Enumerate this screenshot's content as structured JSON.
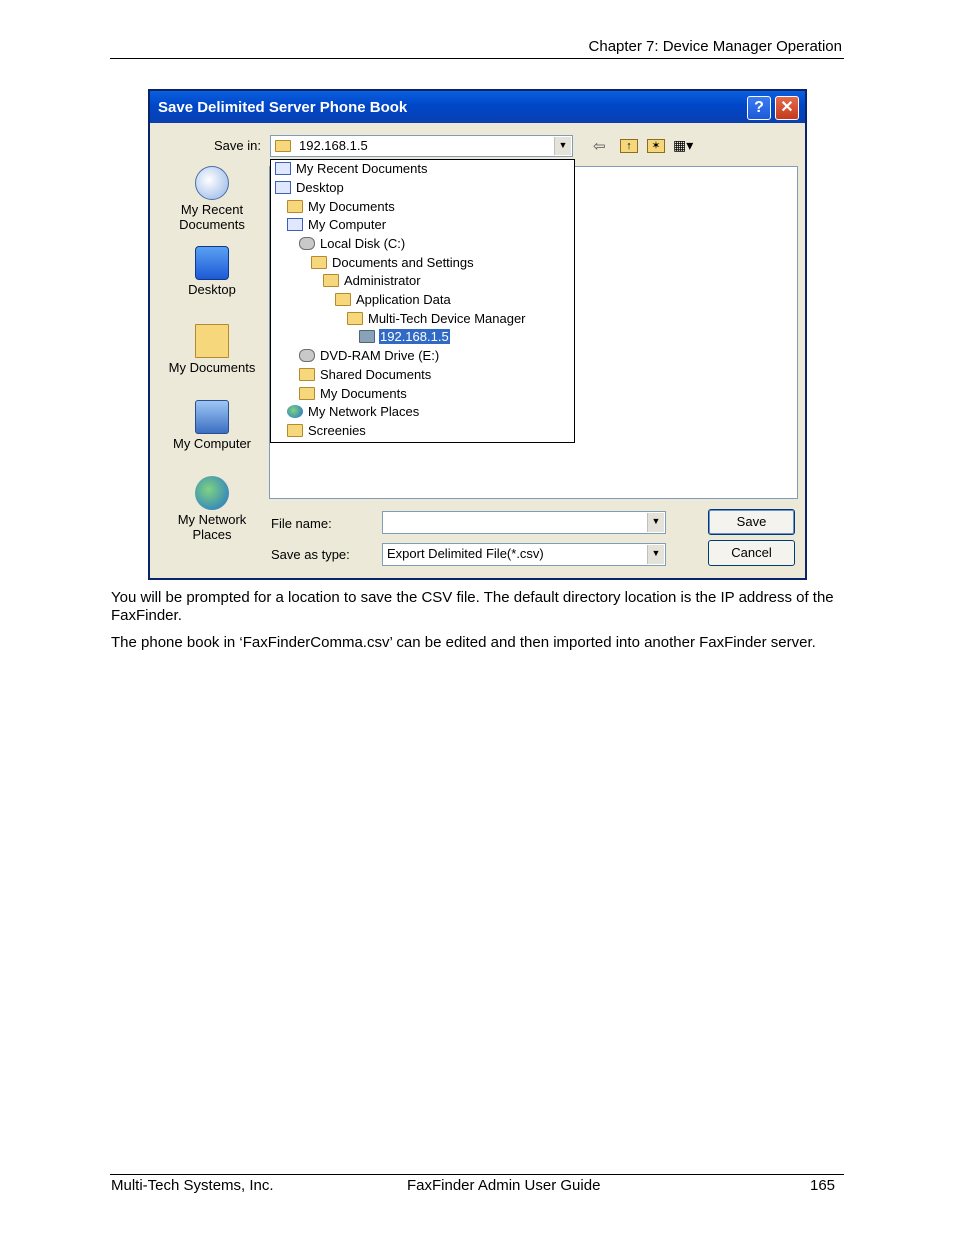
{
  "header": {
    "chapter": "Chapter 7: Device Manager Operation"
  },
  "dialog": {
    "title": "Save Delimited Server Phone Book",
    "help_glyph": "?",
    "close_glyph": "✕",
    "save_in_label": "Save in:",
    "save_in_value": "192.168.1.5",
    "places": [
      {
        "label_line1": "My Recent",
        "label_line2": "Documents",
        "icon": "recent-documents-icon"
      },
      {
        "label_line1": "Desktop",
        "label_line2": "",
        "icon": "desktop-icon"
      },
      {
        "label_line1": "My Documents",
        "label_line2": "",
        "icon": "my-documents-icon"
      },
      {
        "label_line1": "My Computer",
        "label_line2": "",
        "icon": "my-computer-icon"
      },
      {
        "label_line1": "My Network",
        "label_line2": "Places",
        "icon": "network-places-icon"
      }
    ],
    "dropdown_items": [
      {
        "label": "My Recent Documents",
        "icon": "recent-icon"
      },
      {
        "label": "Desktop",
        "icon": "desktop-icon"
      },
      {
        "label": "My Documents",
        "icon": "folder-icon"
      },
      {
        "label": "My Computer",
        "icon": "computer-icon"
      },
      {
        "label": "Local Disk (C:)",
        "icon": "drive-icon"
      },
      {
        "label": "Documents and Settings",
        "icon": "folder-icon"
      },
      {
        "label": "Administrator",
        "icon": "folder-icon"
      },
      {
        "label": "Application Data",
        "icon": "folder-icon"
      },
      {
        "label": "Multi-Tech Device Manager",
        "icon": "folder-icon"
      },
      {
        "label": "192.168.1.5",
        "icon": "folder-open-icon",
        "selected": true
      },
      {
        "label": "DVD-RAM Drive (E:)",
        "icon": "dvd-drive-icon"
      },
      {
        "label": "Shared Documents",
        "icon": "folder-icon"
      },
      {
        "label": "My Documents",
        "icon": "folder-icon"
      },
      {
        "label": "My Network Places",
        "icon": "network-icon"
      },
      {
        "label": "Screenies",
        "icon": "folder-icon"
      }
    ],
    "file_name_label": "File name:",
    "file_name_value": "",
    "save_as_type_label": "Save as type:",
    "save_as_type_value": "Export Delimited File(*.csv)",
    "save_button": "Save",
    "cancel_button": "Cancel"
  },
  "body": {
    "para1": "You will be prompted for a location to save the CSV file. The default directory location is the IP address of the FaxFinder.",
    "para2": "The phone book in ‘FaxFinderComma.csv’ can be edited and then imported into another FaxFinder server."
  },
  "footer": {
    "company": "Multi-Tech Systems, Inc.",
    "guide": "FaxFinder Admin User Guide",
    "page": "165"
  }
}
